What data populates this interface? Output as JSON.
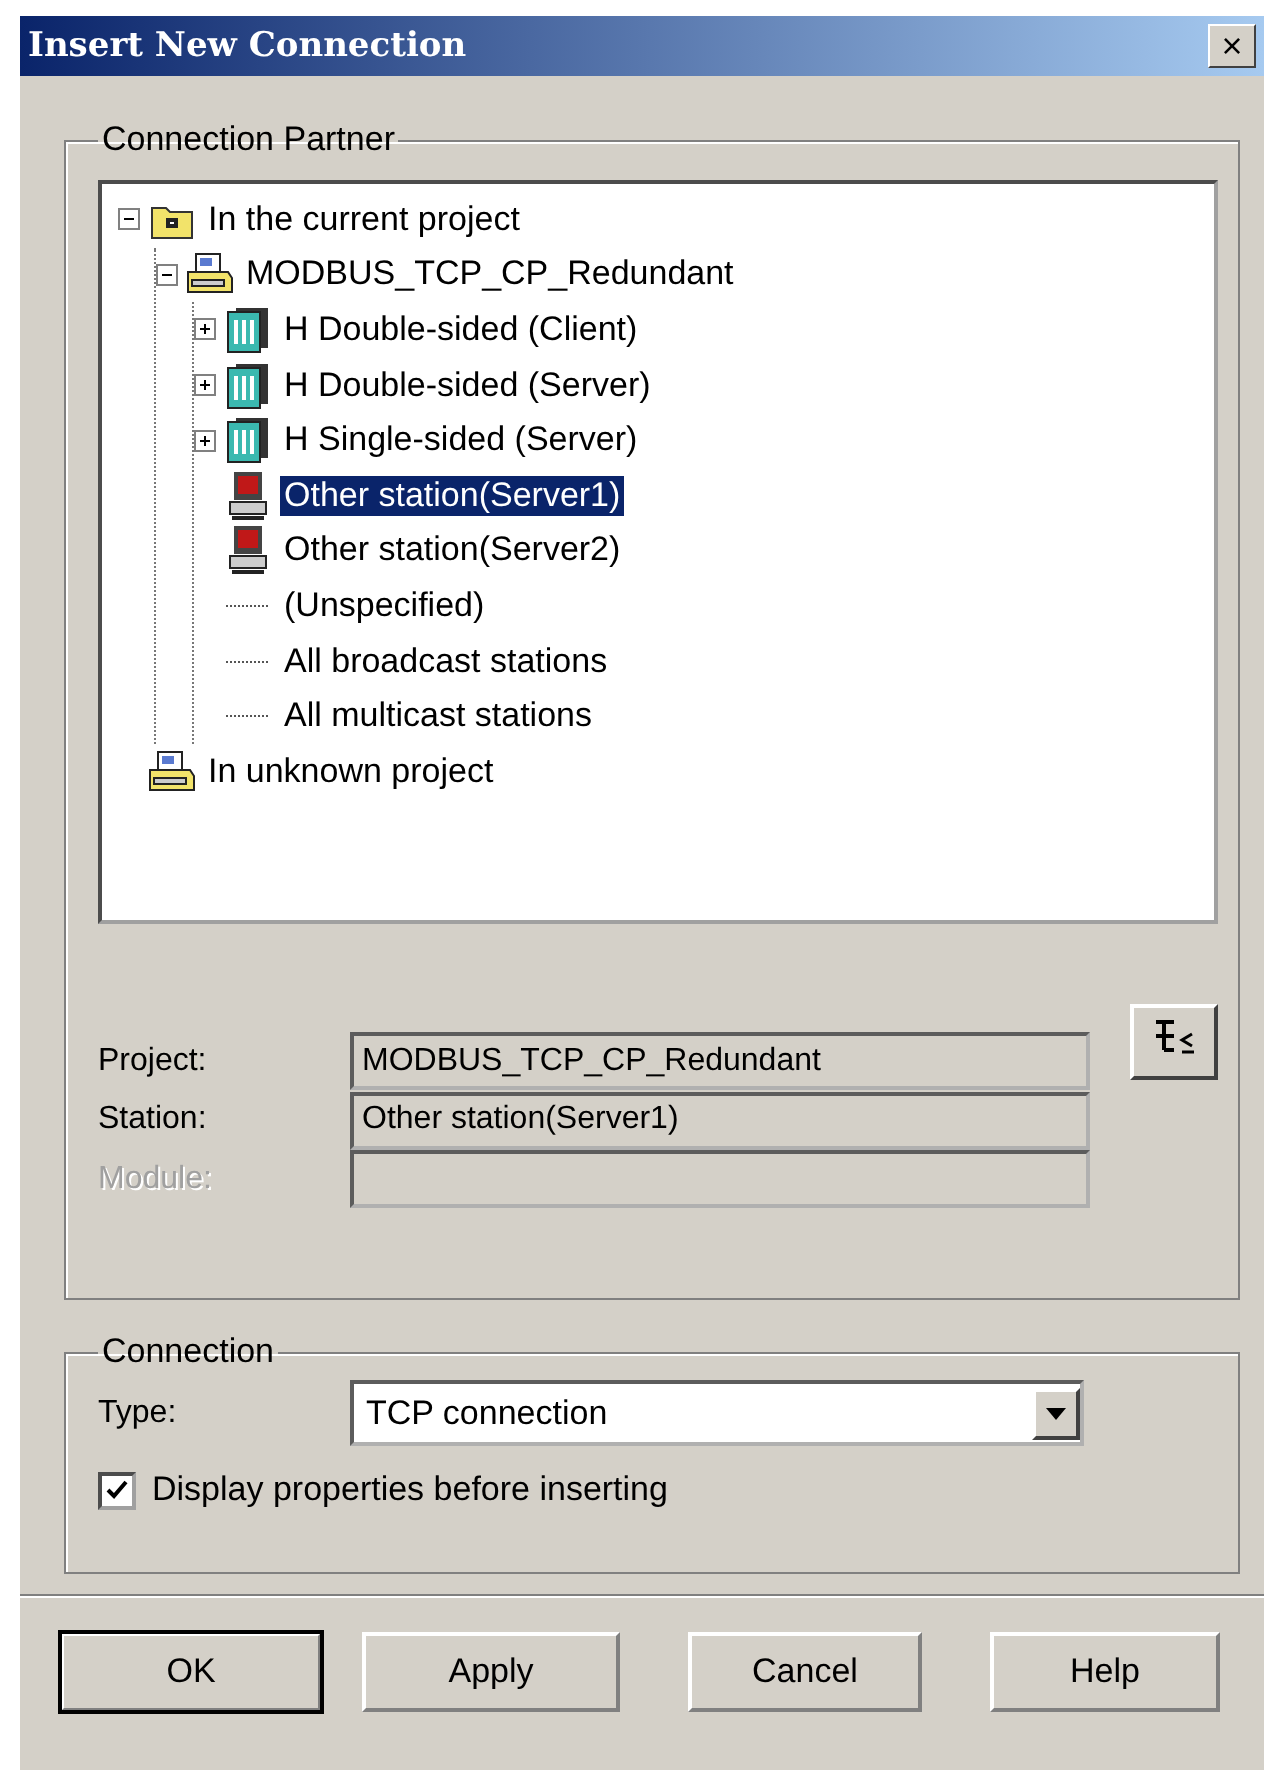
{
  "window": {
    "title": "Insert New Connection",
    "close": "×"
  },
  "connection_partner": {
    "title": "Connection Partner",
    "tree": [
      {
        "label": "In the current project",
        "kind": "folder",
        "expanded": true,
        "selected": false,
        "children": [
          {
            "label": "MODBUS_TCP_CP_Redundant",
            "kind": "project",
            "expanded": true,
            "selected": false,
            "children": [
              {
                "label": "H Double-sided (Client)",
                "kind": "h-station",
                "expanded": false,
                "selected": false
              },
              {
                "label": "H Double-sided (Server)",
                "kind": "h-station",
                "expanded": false,
                "selected": false
              },
              {
                "label": "H Single-sided (Server)",
                "kind": "h-station",
                "expanded": false,
                "selected": false
              },
              {
                "label": "Other station(Server1)",
                "kind": "other-station",
                "selected": true
              },
              {
                "label": "Other station(Server2)",
                "kind": "other-station",
                "selected": false
              },
              {
                "label": "(Unspecified)",
                "kind": "none",
                "selected": false
              },
              {
                "label": "All broadcast stations",
                "kind": "none",
                "selected": false
              },
              {
                "label": "All multicast stations",
                "kind": "none",
                "selected": false
              }
            ]
          }
        ]
      },
      {
        "label": "In unknown project",
        "kind": "project",
        "selected": false
      }
    ],
    "fields": [
      {
        "label": "Project:",
        "value": "MODBUS_TCP_CP_Redundant",
        "disabled": false
      },
      {
        "label": "Station:",
        "value": "Other station(Server1)",
        "disabled": false
      },
      {
        "label": "Module:",
        "disabled": true
      }
    ]
  },
  "connection": {
    "title": "Connection",
    "type_label": "Type:",
    "type_value": "TCP connection",
    "display_properties": {
      "label": "Display properties before inserting",
      "checked": true
    }
  },
  "buttons": [
    {
      "label": "OK",
      "default": true
    },
    {
      "label": "Apply",
      "default": false
    },
    {
      "label": "Cancel",
      "default": false
    },
    {
      "label": "Help",
      "default": false
    }
  ]
}
